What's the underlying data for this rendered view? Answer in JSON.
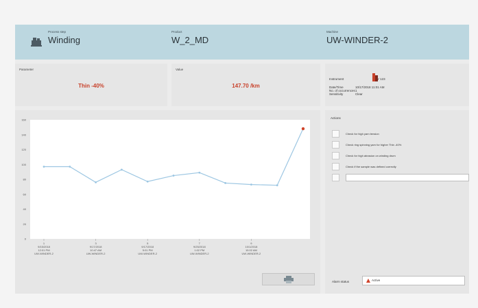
{
  "header": {
    "process_step_label": "Process step",
    "process_step": "Winding",
    "product_label": "Product",
    "product": "W_2_MD",
    "machine_label": "Machine",
    "machine": "UW-WINDER-2"
  },
  "parameter": {
    "label": "Parameter",
    "value": "Thin -40%"
  },
  "value": {
    "label": "Value",
    "value": "147.70 /km"
  },
  "instrument": {
    "instrument_label": "Instrument",
    "instrument_value": "Y 123",
    "datetime_label": "Date/Time",
    "datetime_value": "10/17/2018 11:01 AM",
    "occurrences_label": "No. of occurrences",
    "occurrences_value": "1",
    "sensitivity_label": "Sensitivity",
    "sensitivity_value": "Clear"
  },
  "actions": {
    "title": "Actions",
    "items": [
      "Check for high yarn tension",
      "Check ring spinning yarn for higher Thin -40%",
      "Check for high abrasion on winding drum",
      "Check if the sample was defined correctly"
    ]
  },
  "alarm": {
    "label": "Alarm status",
    "value": "Active",
    "color": "#d0442b"
  },
  "colors": {
    "header": "#bcd7e0",
    "accent_red": "#c8412a",
    "line": "#9cc6e2"
  },
  "chart_data": {
    "type": "line",
    "ylim": [
      0,
      160
    ],
    "yticks": [
      0,
      20,
      40,
      60,
      80,
      100,
      120,
      140,
      160
    ],
    "x": [
      1,
      2,
      3,
      4,
      5,
      6,
      7,
      8,
      9,
      10,
      11
    ],
    "values": [
      97,
      97,
      76,
      93,
      77,
      85,
      89,
      75,
      73,
      72,
      148
    ],
    "highlight_index": 10,
    "xlabels": [
      {
        "idx": 0,
        "lines": [
          "1",
          "9/15/2018",
          "12:01 PM",
          "UW-WINDER-2"
        ]
      },
      {
        "idx": 2,
        "lines": [
          "3",
          "9/17/2018",
          "10:47 AM",
          "UW-WINDER-2"
        ]
      },
      {
        "idx": 4,
        "lines": [
          "5",
          "9/17/2018",
          "5:01 PM",
          "UW-WINDER-2"
        ]
      },
      {
        "idx": 6,
        "lines": [
          "7",
          "9/25/2018",
          "1:02 PM",
          "UW-WINDER-2"
        ]
      },
      {
        "idx": 8,
        "lines": [
          "9",
          "10/1/2018",
          "10:02 AM",
          "UW-WINDER-2"
        ]
      }
    ]
  }
}
